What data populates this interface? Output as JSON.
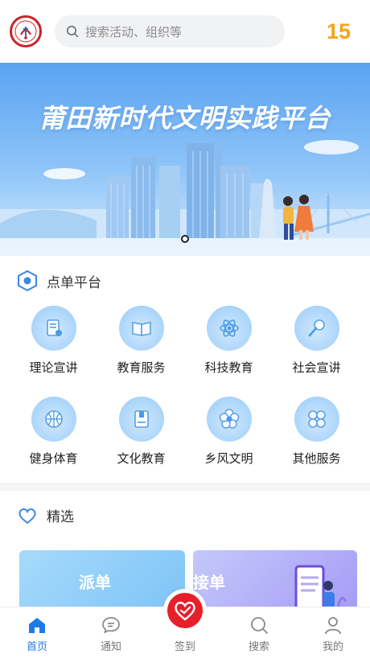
{
  "header": {
    "logo_icon": "emblem-icon",
    "search_placeholder": "搜索活动、组织等",
    "counter": "15"
  },
  "banner": {
    "title": "莆田新时代文明实践平台"
  },
  "platform": {
    "title": "点单平台",
    "items": [
      {
        "label": "理论宣讲",
        "icon": "document-icon"
      },
      {
        "label": "教育服务",
        "icon": "book-icon"
      },
      {
        "label": "科技教育",
        "icon": "atom-icon"
      },
      {
        "label": "社会宣讲",
        "icon": "microphone-icon"
      },
      {
        "label": "健身体育",
        "icon": "ball-icon"
      },
      {
        "label": "文化教育",
        "icon": "notebook-icon"
      },
      {
        "label": "乡风文明",
        "icon": "flower-icon"
      },
      {
        "label": "其他服务",
        "icon": "grid-icon"
      }
    ]
  },
  "featured": {
    "title": "精选",
    "cards": [
      {
        "title": "派单"
      },
      {
        "title": "接单"
      }
    ]
  },
  "tabbar": {
    "items": [
      {
        "label": "首页",
        "icon": "home-icon"
      },
      {
        "label": "通知",
        "icon": "message-icon"
      },
      {
        "label": "签到",
        "icon": "heart-checkin-icon"
      },
      {
        "label": "搜索",
        "icon": "search-icon"
      },
      {
        "label": "我的",
        "icon": "user-icon"
      }
    ]
  },
  "colors": {
    "accent": "#1f7ae6",
    "counter": "#f5a31a",
    "checkin": "#e6202a"
  }
}
